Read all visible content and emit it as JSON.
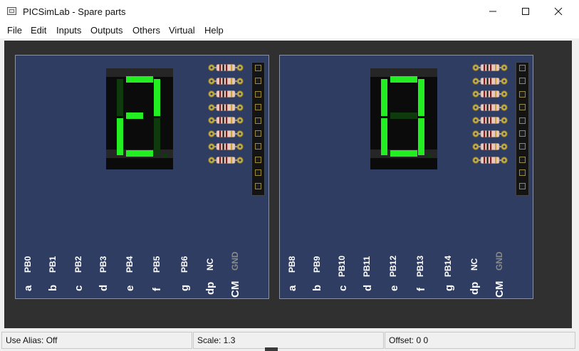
{
  "window": {
    "title": "PICSimLab - Spare parts"
  },
  "menu": {
    "items": [
      "File",
      "Edit",
      "Inputs",
      "Outputs",
      "Others",
      "Virtual",
      "Help"
    ]
  },
  "colors": {
    "board_bg": "#2f3d63",
    "segment_on": "#22ee22",
    "segment_off": "#0e3a0e",
    "workspace_bg": "#303030"
  },
  "boards": [
    {
      "digit_shown": "2",
      "segments_lit": {
        "a": true,
        "b": true,
        "c": false,
        "d": true,
        "e": true,
        "f": false,
        "g": true,
        "dp": false
      },
      "pins": [
        "PB0",
        "PB1",
        "PB2",
        "PB3",
        "PB4",
        "PB5",
        "PB6",
        "NC",
        "GND"
      ],
      "segment_labels": [
        "a",
        "b",
        "c",
        "d",
        "e",
        "f",
        "g",
        "dp",
        "CM"
      ]
    },
    {
      "digit_shown": "0",
      "segments_lit": {
        "a": true,
        "b": true,
        "c": true,
        "d": true,
        "e": true,
        "f": true,
        "g": false,
        "dp": false
      },
      "pins": [
        "PB8",
        "PB9",
        "PB10",
        "PB11",
        "PB12",
        "PB13",
        "PB14",
        "NC",
        "GND"
      ],
      "segment_labels": [
        "a",
        "b",
        "c",
        "d",
        "e",
        "f",
        "g",
        "dp",
        "CM"
      ]
    }
  ],
  "status": {
    "alias": "Use Alias: Off",
    "scale": "Scale: 1.3",
    "offset": "Offset:  0  0"
  }
}
